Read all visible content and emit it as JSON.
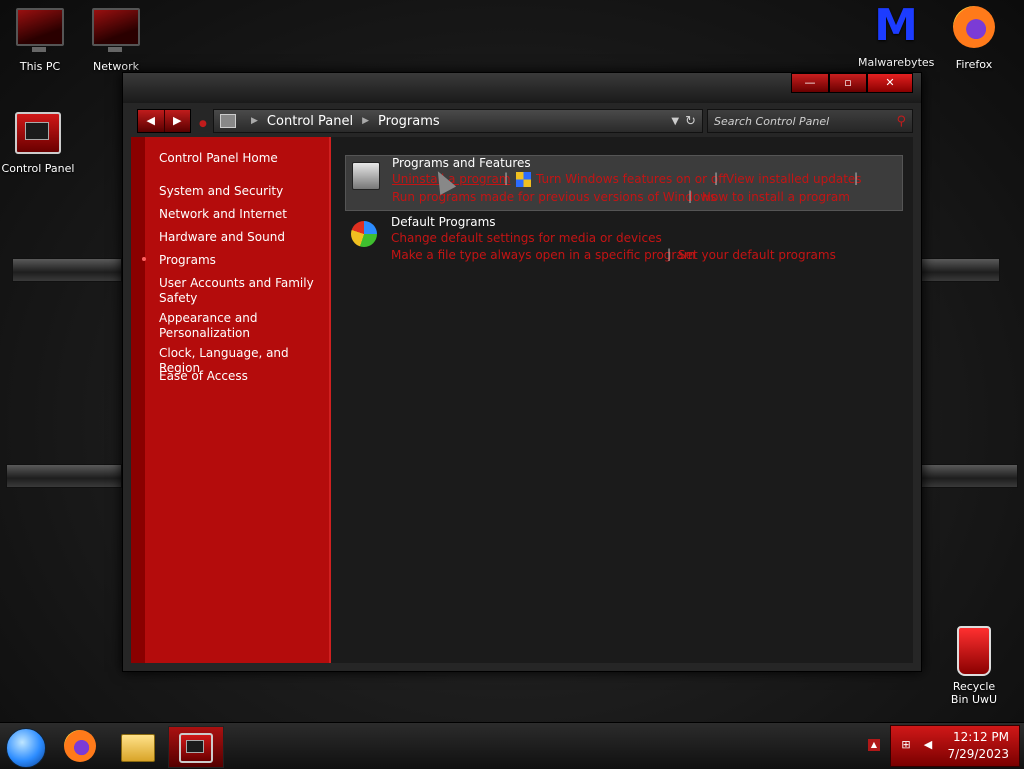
{
  "desktop": {
    "icons": [
      {
        "label": "This PC",
        "icon": "monitor-icon"
      },
      {
        "label": "Network",
        "icon": "network-monitor-icon"
      },
      {
        "label": "Control Panel",
        "icon": "control-panel-icon"
      },
      {
        "label": "Malwarebytes",
        "icon": "malwarebytes-icon"
      },
      {
        "label": "Firefox",
        "icon": "firefox-icon"
      },
      {
        "label": "Recycle Bin UwU",
        "icon": "recycle-bin-icon"
      }
    ]
  },
  "window": {
    "controls": {
      "minimize": "—",
      "maximize": "▫",
      "close": "✕"
    },
    "nav": {
      "back": "◀",
      "forward": "▶"
    },
    "breadcrumb": [
      "Control Panel",
      "Programs"
    ],
    "search_placeholder": "Search Control Panel",
    "accent": "#c41414"
  },
  "sidebar": {
    "items": [
      {
        "label": "Control Panel Home"
      },
      {
        "label": "System and Security"
      },
      {
        "label": "Network and Internet"
      },
      {
        "label": "Hardware and Sound"
      },
      {
        "label": "Programs",
        "current": true
      },
      {
        "label": "User Accounts and Family Safety"
      },
      {
        "label": "Appearance and Personalization"
      },
      {
        "label": "Clock, Language, and Region"
      },
      {
        "label": "Ease of Access"
      }
    ]
  },
  "main": {
    "groups": [
      {
        "title": "Programs and Features",
        "icon": "programs-features-icon",
        "links": [
          "Uninstall a program",
          "Turn Windows features on or off",
          "View installed updates",
          "Run programs made for previous versions of Windows",
          "How to install a program"
        ]
      },
      {
        "title": "Default Programs",
        "icon": "default-programs-icon",
        "links": [
          "Change default settings for media or devices",
          "Make a file type always open in a specific program",
          "Set your default programs"
        ]
      }
    ]
  },
  "taskbar": {
    "apps": [
      "start-orb-icon",
      "firefox-icon",
      "file-explorer-icon",
      "control-panel-icon"
    ],
    "tray_expand": "▲",
    "time": "12:12 PM",
    "date": "7/29/2023"
  }
}
